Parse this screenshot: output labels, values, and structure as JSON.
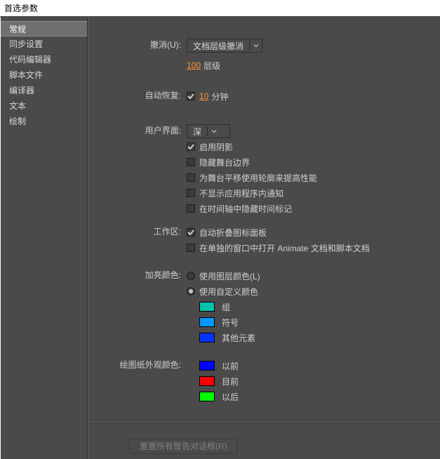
{
  "window": {
    "title": "首选参数"
  },
  "sidebar": {
    "items": [
      {
        "label": "常规",
        "active": true
      },
      {
        "label": "同步设置"
      },
      {
        "label": "代码编辑器"
      },
      {
        "label": "脚本文件"
      },
      {
        "label": "编译器"
      },
      {
        "label": "文本"
      },
      {
        "label": "绘制"
      }
    ]
  },
  "undo": {
    "label": "撤消(U):",
    "dropdown_value": "文档层级撤消",
    "levels_value": "100",
    "levels_unit": "层级"
  },
  "autorecover": {
    "label": "自动恢复:",
    "checked": true,
    "value": "10",
    "unit": "分钟"
  },
  "ui": {
    "label": "用户界面:",
    "theme_value": "深",
    "items": [
      {
        "checked": true,
        "label": "启用阴影"
      },
      {
        "checked": false,
        "label": "隐藏舞台边界"
      },
      {
        "checked": false,
        "label": "为舞台平移使用轮廓来提高性能"
      },
      {
        "checked": false,
        "label": "不显示应用程序内通知"
      },
      {
        "checked": false,
        "label": "在时间轴中隐藏时间标记"
      }
    ]
  },
  "workspace": {
    "label": "工作区:",
    "items": [
      {
        "checked": true,
        "label": "自动折叠图标面板"
      },
      {
        "checked": false,
        "label": "在单独的窗口中打开 Animate 文档和脚本文档"
      }
    ]
  },
  "highlight": {
    "label": "加亮颜色:",
    "radios": [
      {
        "selected": false,
        "label": "使用图层颜色(L)"
      },
      {
        "selected": true,
        "label": "使用自定义颜色"
      }
    ],
    "swatches": [
      {
        "color": "#00c2a8",
        "label": "组"
      },
      {
        "color": "#0099ff",
        "label": "符号"
      },
      {
        "color": "#0033ff",
        "label": "其他元素"
      }
    ]
  },
  "onion": {
    "label": "绘图纸外观颜色:",
    "swatches": [
      {
        "color": "#0000ff",
        "label": "以前"
      },
      {
        "color": "#ff0000",
        "label": "目前"
      },
      {
        "color": "#00ff00",
        "label": "以后"
      }
    ]
  },
  "footer": {
    "reset_button": "重置所有警告对话框(R)"
  }
}
